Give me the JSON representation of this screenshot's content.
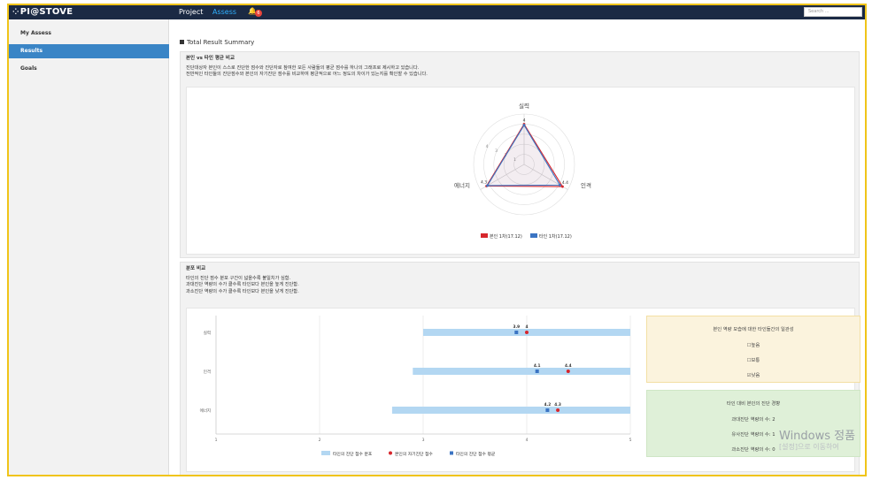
{
  "topbar": {
    "logo": "PI@STOVE",
    "nav": [
      "Project",
      "Assess"
    ],
    "bell_count": "6",
    "search_placeholder": "Search ..."
  },
  "sidebar": {
    "items": [
      {
        "label": "My Assess"
      },
      {
        "label": "Results"
      },
      {
        "label": "Goals"
      }
    ]
  },
  "main": {
    "section_title": "Total Result Summary",
    "panel1": {
      "heading": "본인 vs 타인 평균 비교",
      "desc1": "진단대상자 본인이 스스로 진단한 점수와 진단자로 참여한 모든 사람들의 평균 점수를 하나의 그래프로 제시하고 있습니다.",
      "desc2": "전반적인 타인들의 진단점수와 본인의 자기진단 점수를 비교하여 평균적으로 어느 정도의 차이가 있는지를 확인할 수 있습니다."
    },
    "panel2": {
      "heading": "분포 비교",
      "desc1": "타인의 진단 점수 분포 구간이 넓을수록 불일치가 심함.",
      "desc2": "과대진단 역량의 수가 클수록 타인보다 본인을 높게 진단함.",
      "desc3": "과소진단 역량의 수가 클수록 타인보다 본인을 낮게 진단함."
    },
    "consistency_box": {
      "title": "본인 역량 모습에 대한 타인들간의 일관성",
      "options": [
        {
          "label": "높음",
          "checked": false
        },
        {
          "label": "보통",
          "checked": false
        },
        {
          "label": "낮음",
          "checked": true
        }
      ]
    },
    "tendency_box": {
      "title": "타인 대비 본인의 진단 경향",
      "lines": [
        "과대진단 역량의 수: 2",
        "유사진단 역량의 수: 1",
        "과소진단 역량의 수: 0"
      ]
    }
  },
  "chart_data": [
    {
      "type": "radar",
      "axes": [
        "실력",
        "인격",
        "에너지"
      ],
      "tick_labels": [
        "1",
        "2",
        "3",
        "4"
      ],
      "series": [
        {
          "name": "본인 1차(17.12)",
          "color": "#d7262c",
          "values": [
            4,
            4.4,
            4.3
          ]
        },
        {
          "name": "타인 1차(17.12)",
          "color": "#3b74c3",
          "values": [
            3.9,
            4.1,
            4.2
          ]
        }
      ],
      "point_labels": [
        [
          "4",
          "4.4",
          "4.3"
        ],
        [
          "3.9",
          "4.1",
          "4.2"
        ]
      ]
    },
    {
      "type": "bar",
      "orientation": "horizontal",
      "categories": [
        "실력",
        "인격",
        "에너지"
      ],
      "xlim": [
        1,
        5
      ],
      "xticks": [
        "1",
        "2",
        "3",
        "4",
        "5"
      ],
      "series": [
        {
          "name": "타인의 진단 점수 분포",
          "color": "#b3d7f2",
          "ranges": [
            [
              3,
              5
            ],
            [
              2.9,
              5
            ],
            [
              2.7,
              5
            ]
          ]
        },
        {
          "name": "본인의 자기진단 점수",
          "color": "#d7262c",
          "values": [
            4,
            4.4,
            4.3
          ]
        },
        {
          "name": "타인의 진단 점수 평균",
          "color": "#3b74c3",
          "values": [
            3.9,
            4.1,
            4.2
          ]
        }
      ],
      "data_labels": {
        "self": [
          "4",
          "4.4",
          "4.3"
        ],
        "others": [
          "3.9",
          "4.1",
          "4.2"
        ]
      }
    }
  ],
  "watermark": {
    "line1": "Windows 정품",
    "line2": "[설정]으로 이동하여"
  }
}
